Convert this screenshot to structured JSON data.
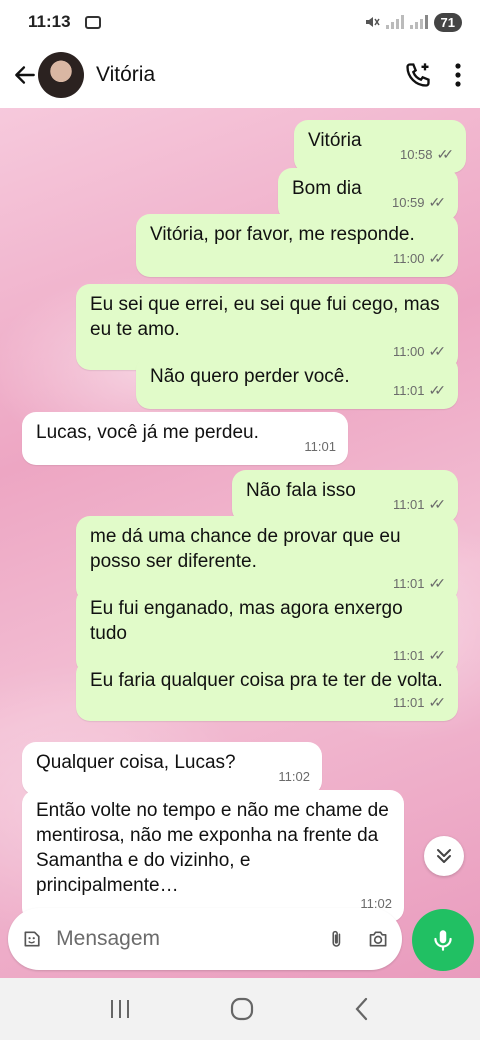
{
  "status_bar": {
    "time": "11:13",
    "battery": "71"
  },
  "header": {
    "contact_name": "Vitória"
  },
  "messages": [
    {
      "dir": "out",
      "text": "Vitória",
      "time": "10:58"
    },
    {
      "dir": "out",
      "text": "Bom dia",
      "time": "10:59"
    },
    {
      "dir": "out",
      "text": "Vitória, por favor, me responde.",
      "time": "11:00"
    },
    {
      "dir": "out",
      "text": "Eu sei que errei, eu sei que fui cego, mas eu te amo.",
      "time": "11:00"
    },
    {
      "dir": "out",
      "text": "Não quero perder você.",
      "time": "11:01"
    },
    {
      "dir": "in",
      "text": "Lucas, você já me perdeu.",
      "time": "11:01"
    },
    {
      "dir": "out",
      "text": "Não fala isso",
      "time": "11:01"
    },
    {
      "dir": "out",
      "text": "me dá uma chance de provar que eu posso ser diferente.",
      "time": "11:01"
    },
    {
      "dir": "out",
      "text": "Eu fui enganado, mas agora enxergo tudo",
      "time": "11:01"
    },
    {
      "dir": "out",
      "text": "Eu faria qualquer coisa pra te ter de volta.",
      "time": "11:01"
    },
    {
      "dir": "in",
      "text": "Qualquer coisa, Lucas?",
      "time": "11:02"
    },
    {
      "dir": "in",
      "text": "Então volte no tempo e não me chame de mentirosa, não me exponha na frente da Samantha e do vizinho, e principalmente…",
      "time": "11:02"
    }
  ],
  "composer": {
    "placeholder": "Mensagem"
  },
  "icons": {
    "back": "arrow-left-icon",
    "call": "add-call-icon",
    "menu": "more-vert-icon",
    "sticker": "sticker-icon",
    "attach": "paperclip-icon",
    "camera": "camera-icon",
    "mic": "microphone-icon",
    "scroll_down": "double-chevron-down-icon"
  },
  "colors": {
    "outgoing": "#e1fbc9",
    "incoming": "#ffffff",
    "accent": "#21c063",
    "wallpaper": "#eda6c3"
  }
}
